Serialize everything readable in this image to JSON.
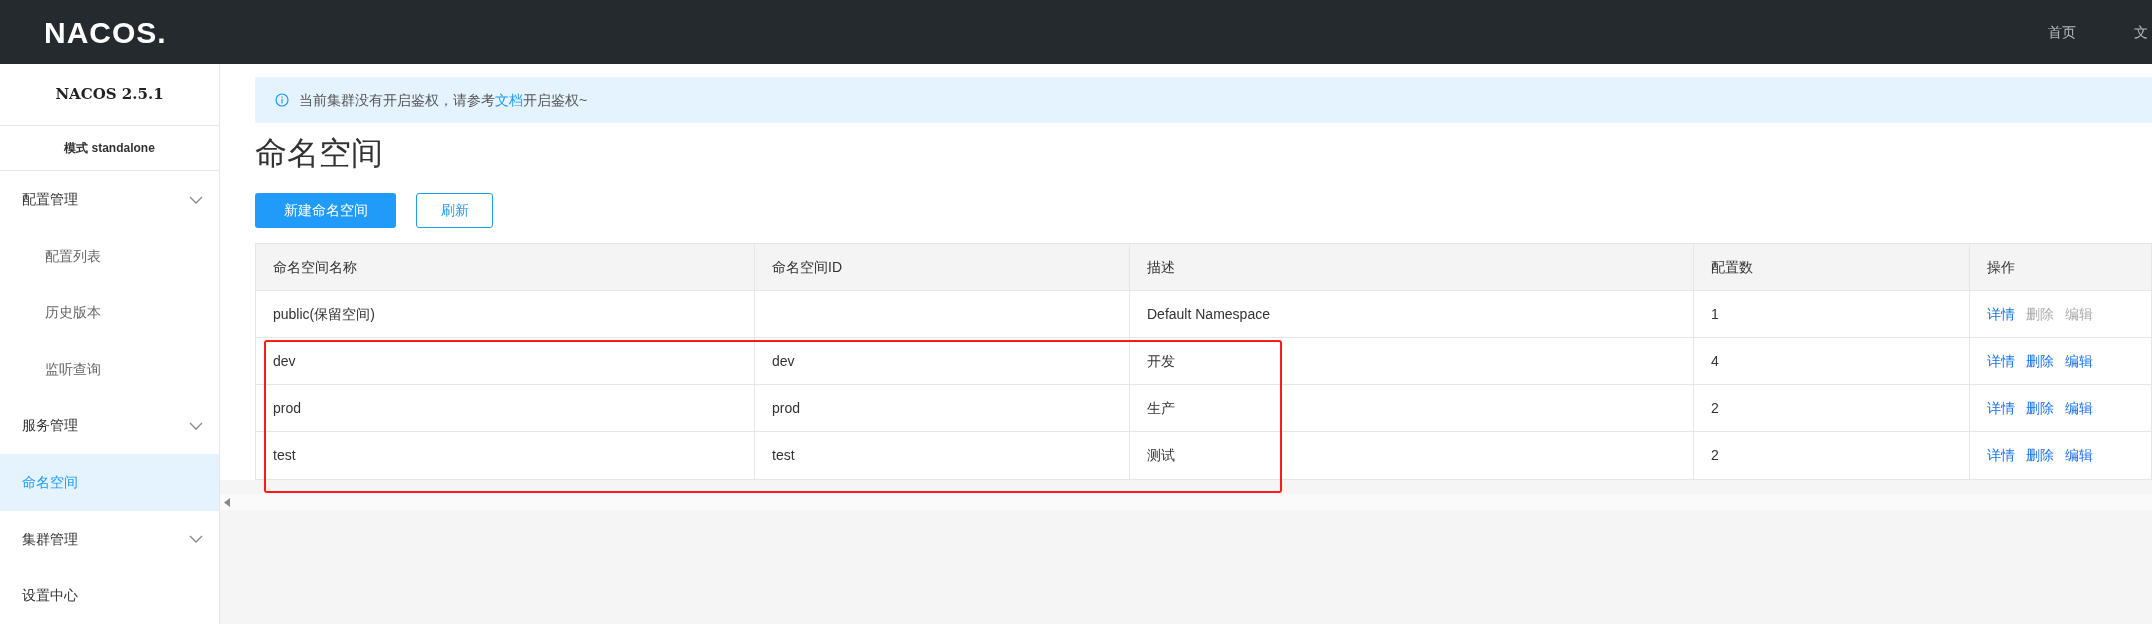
{
  "header": {
    "logo": "NACOS.",
    "nav": [
      {
        "label": "首页"
      },
      {
        "label": "文"
      }
    ]
  },
  "sidebar": {
    "version": "NACOS 2.5.1",
    "mode": "模式 standalone",
    "items": [
      {
        "kind": "group",
        "label": "配置管理",
        "selected": false,
        "children": [
          {
            "label": "配置列表",
            "selected": false
          },
          {
            "label": "历史版本",
            "selected": false
          },
          {
            "label": "监听查询",
            "selected": false
          }
        ]
      },
      {
        "kind": "group",
        "label": "服务管理",
        "selected": false
      },
      {
        "kind": "link",
        "label": "命名空间",
        "selected": true
      },
      {
        "kind": "group",
        "label": "集群管理",
        "selected": false
      },
      {
        "kind": "link",
        "label": "设置中心",
        "selected": false
      }
    ]
  },
  "alert": {
    "before": "当前集群没有开启鉴权，请参考",
    "link": "文档",
    "after": "开启鉴权~"
  },
  "page_title": "命名空间",
  "buttons": [
    {
      "kind": "primary",
      "label": "新建命名空间"
    },
    {
      "kind": "outline",
      "label": "刷新"
    }
  ],
  "table": {
    "columns": [
      "命名空间名称",
      "命名空间ID",
      "描述",
      "配置数",
      "操作"
    ],
    "rows": [
      {
        "name": "public(保留空间)",
        "id": "",
        "description": "Default Namespace",
        "count": "1",
        "highlighted": false,
        "actions": [
          {
            "label": "详情",
            "disabled": false
          },
          {
            "label": "删除",
            "disabled": true
          },
          {
            "label": "编辑",
            "disabled": true
          }
        ]
      },
      {
        "name": "dev",
        "id": "dev",
        "description": "开发",
        "count": "4",
        "highlighted": true,
        "actions": [
          {
            "label": "详情",
            "disabled": false
          },
          {
            "label": "删除",
            "disabled": false
          },
          {
            "label": "编辑",
            "disabled": false
          }
        ]
      },
      {
        "name": "prod",
        "id": "prod",
        "description": "生产",
        "count": "2",
        "highlighted": true,
        "actions": [
          {
            "label": "详情",
            "disabled": false
          },
          {
            "label": "删除",
            "disabled": false
          },
          {
            "label": "编辑",
            "disabled": false
          }
        ]
      },
      {
        "name": "test",
        "id": "test",
        "description": "测试",
        "count": "2",
        "highlighted": true,
        "actions": [
          {
            "label": "详情",
            "disabled": false
          },
          {
            "label": "删除",
            "disabled": false
          },
          {
            "label": "编辑",
            "disabled": false
          }
        ]
      }
    ]
  }
}
